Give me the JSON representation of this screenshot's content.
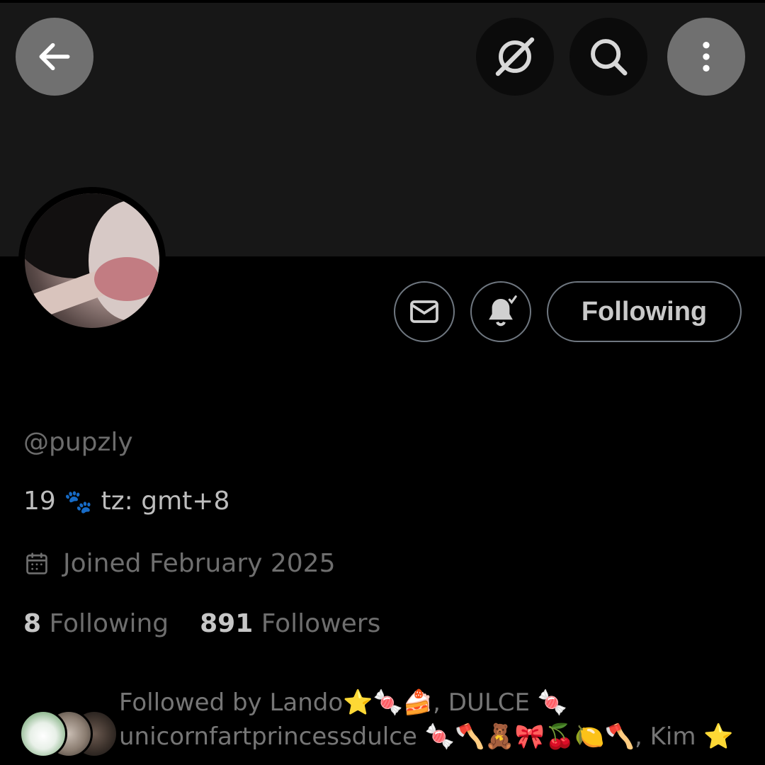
{
  "toolbar": {
    "back_icon": "arrow-left-icon",
    "grok_icon": "grok-icon",
    "search_icon": "search-icon",
    "more_icon": "more-vertical-icon"
  },
  "profile": {
    "handle": "@pupzly",
    "bio_age": "19",
    "bio_emoji": "🐾",
    "bio_tz": "tz: gmt+8",
    "joined": "Joined February 2025",
    "following_count": "8",
    "following_label": "Following",
    "followers_count": "891",
    "followers_label": "Followers"
  },
  "actions": {
    "message_icon": "mail-icon",
    "notify_icon": "bell-check-icon",
    "follow_label": "Following"
  },
  "mutuals": {
    "line1": "Followed by Lando⭐🍬🍰, DULCE 🍬",
    "line2": "unicornfartprincessdulce 🍬🪓🧸🎀🍒🍋🪓, Kim ⭐"
  },
  "colors": {
    "background": "#000000",
    "banner": "#171717",
    "muted_text": "#6e6e6e",
    "primary_text": "#c6c6c6",
    "button_border": "#6f7780"
  }
}
